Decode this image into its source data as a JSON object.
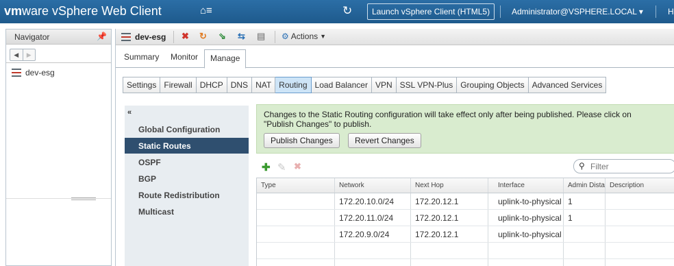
{
  "topbar": {
    "brand_vm": "vm",
    "brand_ware": "ware",
    "product": " vSphere Web Client",
    "launch_label": "Launch vSphere Client (HTML5)",
    "user": "Administrator@VSPHERE.LOCAL",
    "help": "H"
  },
  "navigator": {
    "title": "Navigator",
    "item": "dev-esg"
  },
  "toolbar": {
    "object_name": "dev-esg",
    "actions_label": "Actions"
  },
  "tabs": [
    "Summary",
    "Monitor",
    "Manage"
  ],
  "subtabs": [
    "Settings",
    "Firewall",
    "DHCP",
    "DNS",
    "NAT",
    "Routing",
    "Load Balancer",
    "VPN",
    "SSL VPN-Plus",
    "Grouping Objects",
    "Advanced Services"
  ],
  "routing_menu": [
    "Global Configuration",
    "Static Routes",
    "OSPF",
    "BGP",
    "Route Redistribution",
    "Multicast"
  ],
  "notice": {
    "text": "Changes to the Static Routing configuration will take effect only after being published. Please click on \"Publish Changes\" to publish.",
    "publish_label": "Publish Changes",
    "revert_label": "Revert Changes"
  },
  "filter": {
    "placeholder": "Filter"
  },
  "table": {
    "headers": [
      "Type",
      "Network",
      "Next Hop",
      "Interface",
      "Admin Dista",
      "Description"
    ],
    "rows": [
      [
        "",
        "172.20.10.0/24",
        "172.20.12.1",
        "uplink-to-physical",
        "1",
        ""
      ],
      [
        "",
        "172.20.11.0/24",
        "172.20.12.1",
        "uplink-to-physical",
        "1",
        ""
      ],
      [
        "",
        "172.20.9.0/24",
        "172.20.12.1",
        "uplink-to-physical",
        "",
        ""
      ]
    ]
  },
  "colors": {
    "topbar": "#1e5a8c",
    "active_menu": "#2f4f6f",
    "notice_bg": "#d9eccf",
    "active_subtab": "#cde4f7"
  }
}
